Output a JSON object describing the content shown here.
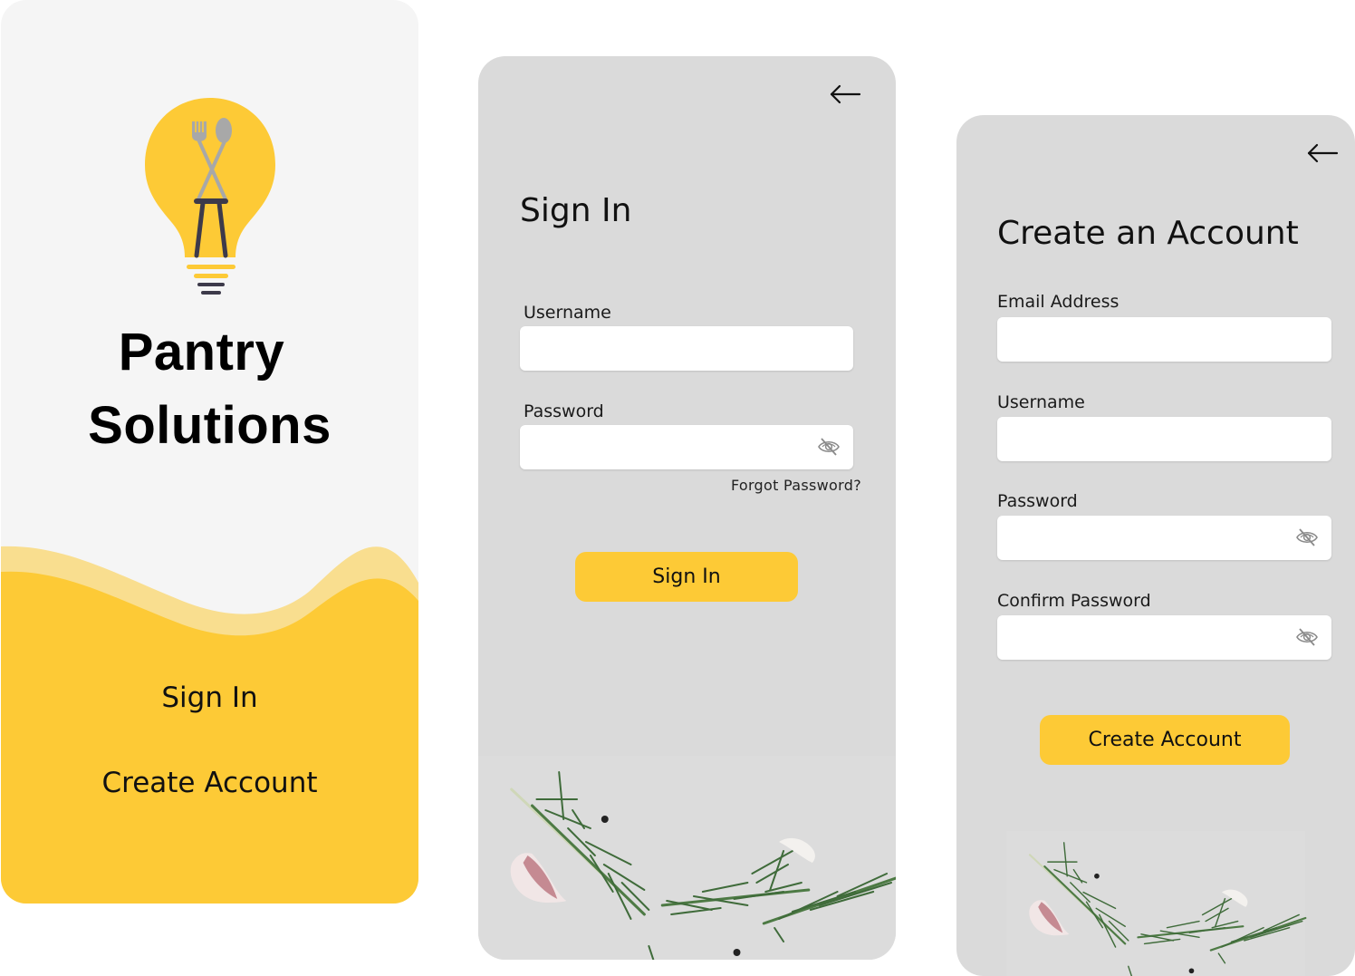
{
  "colors": {
    "accent_yellow": "#fdca36",
    "accent_yellow_light": "#f9de8f",
    "splash_bg": "#f5f5f5",
    "card_bg": "#dadada",
    "field_bg": "#ffffff",
    "text": "#111111",
    "bulb_dark": "#3d3a4a",
    "utensil_gray": "#a8a8a8"
  },
  "splash": {
    "logo_icon": "lightbulb-with-fork-and-spoon",
    "brand_line1": "Pantry",
    "brand_line2": "Solutions",
    "sign_in_label": "Sign In",
    "create_account_label": "Create Account"
  },
  "signin": {
    "back_icon": "arrow-left",
    "title": "Sign In",
    "username_label": "Username",
    "username_value": "",
    "password_label": "Password",
    "password_value": "",
    "password_toggle_icon": "eye-off",
    "forgot_password": "Forgot Password?",
    "submit_label": "Sign In",
    "footer_image": "rosemary-garlic-peppercorns-photo"
  },
  "create": {
    "back_icon": "arrow-left",
    "title": "Create an Account",
    "email_label": "Email Address",
    "email_value": "",
    "username_label": "Username",
    "username_value": "",
    "password_label": "Password",
    "password_value": "",
    "confirm_password_label": "Confirm Password",
    "confirm_password_value": "",
    "password_toggle_icon": "eye-off",
    "submit_label": "Create Account",
    "footer_image": "rosemary-garlic-peppercorns-photo"
  }
}
